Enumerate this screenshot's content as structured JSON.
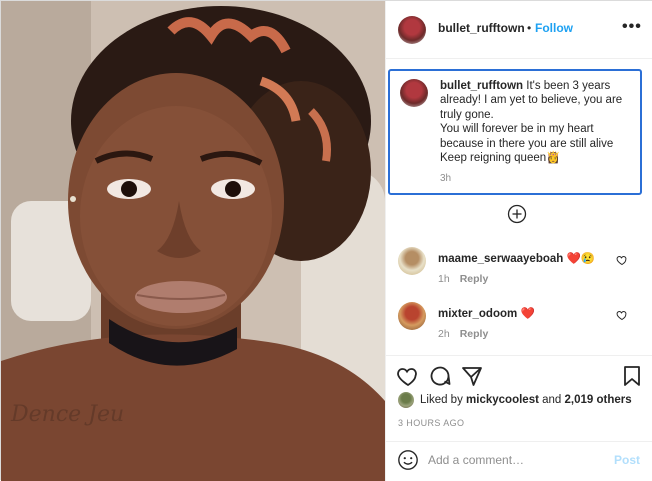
{
  "header": {
    "username": "bullet_rufftown",
    "separator": "•",
    "follow_label": "Follow",
    "more_label": "•••"
  },
  "caption": {
    "username": "bullet_rufftown",
    "line1": "It's been 3 years already! I am yet to believe, you are truly gone.",
    "line2": "You will forever be in my heart because in there you are still alive",
    "line3": "Keep reigning queen👸",
    "time": "3h"
  },
  "comments": [
    {
      "username": "maame_serwaayeboah",
      "text": "❤️😢",
      "time": "1h",
      "reply_label": "Reply"
    },
    {
      "username": "mixter_odoom",
      "text": "❤️",
      "time": "2h",
      "reply_label": "Reply"
    }
  ],
  "likes": {
    "prefix": "Liked by",
    "user": "mickycoolest",
    "conj": "and",
    "count": "2,019 others"
  },
  "time_ago": "3 HOURS AGO",
  "add_comment": {
    "placeholder": "Add a comment…",
    "post_label": "Post"
  },
  "colors": {
    "follow": "#1da1f2",
    "caption_border": "#2b6fd6",
    "post_disabled": "#b2dffc",
    "muted": "#8e8e8e"
  },
  "icons": [
    "more-options-icon",
    "add-circle-icon",
    "heart-icon",
    "comment-icon",
    "share-icon",
    "bookmark-icon",
    "emoji-icon"
  ]
}
